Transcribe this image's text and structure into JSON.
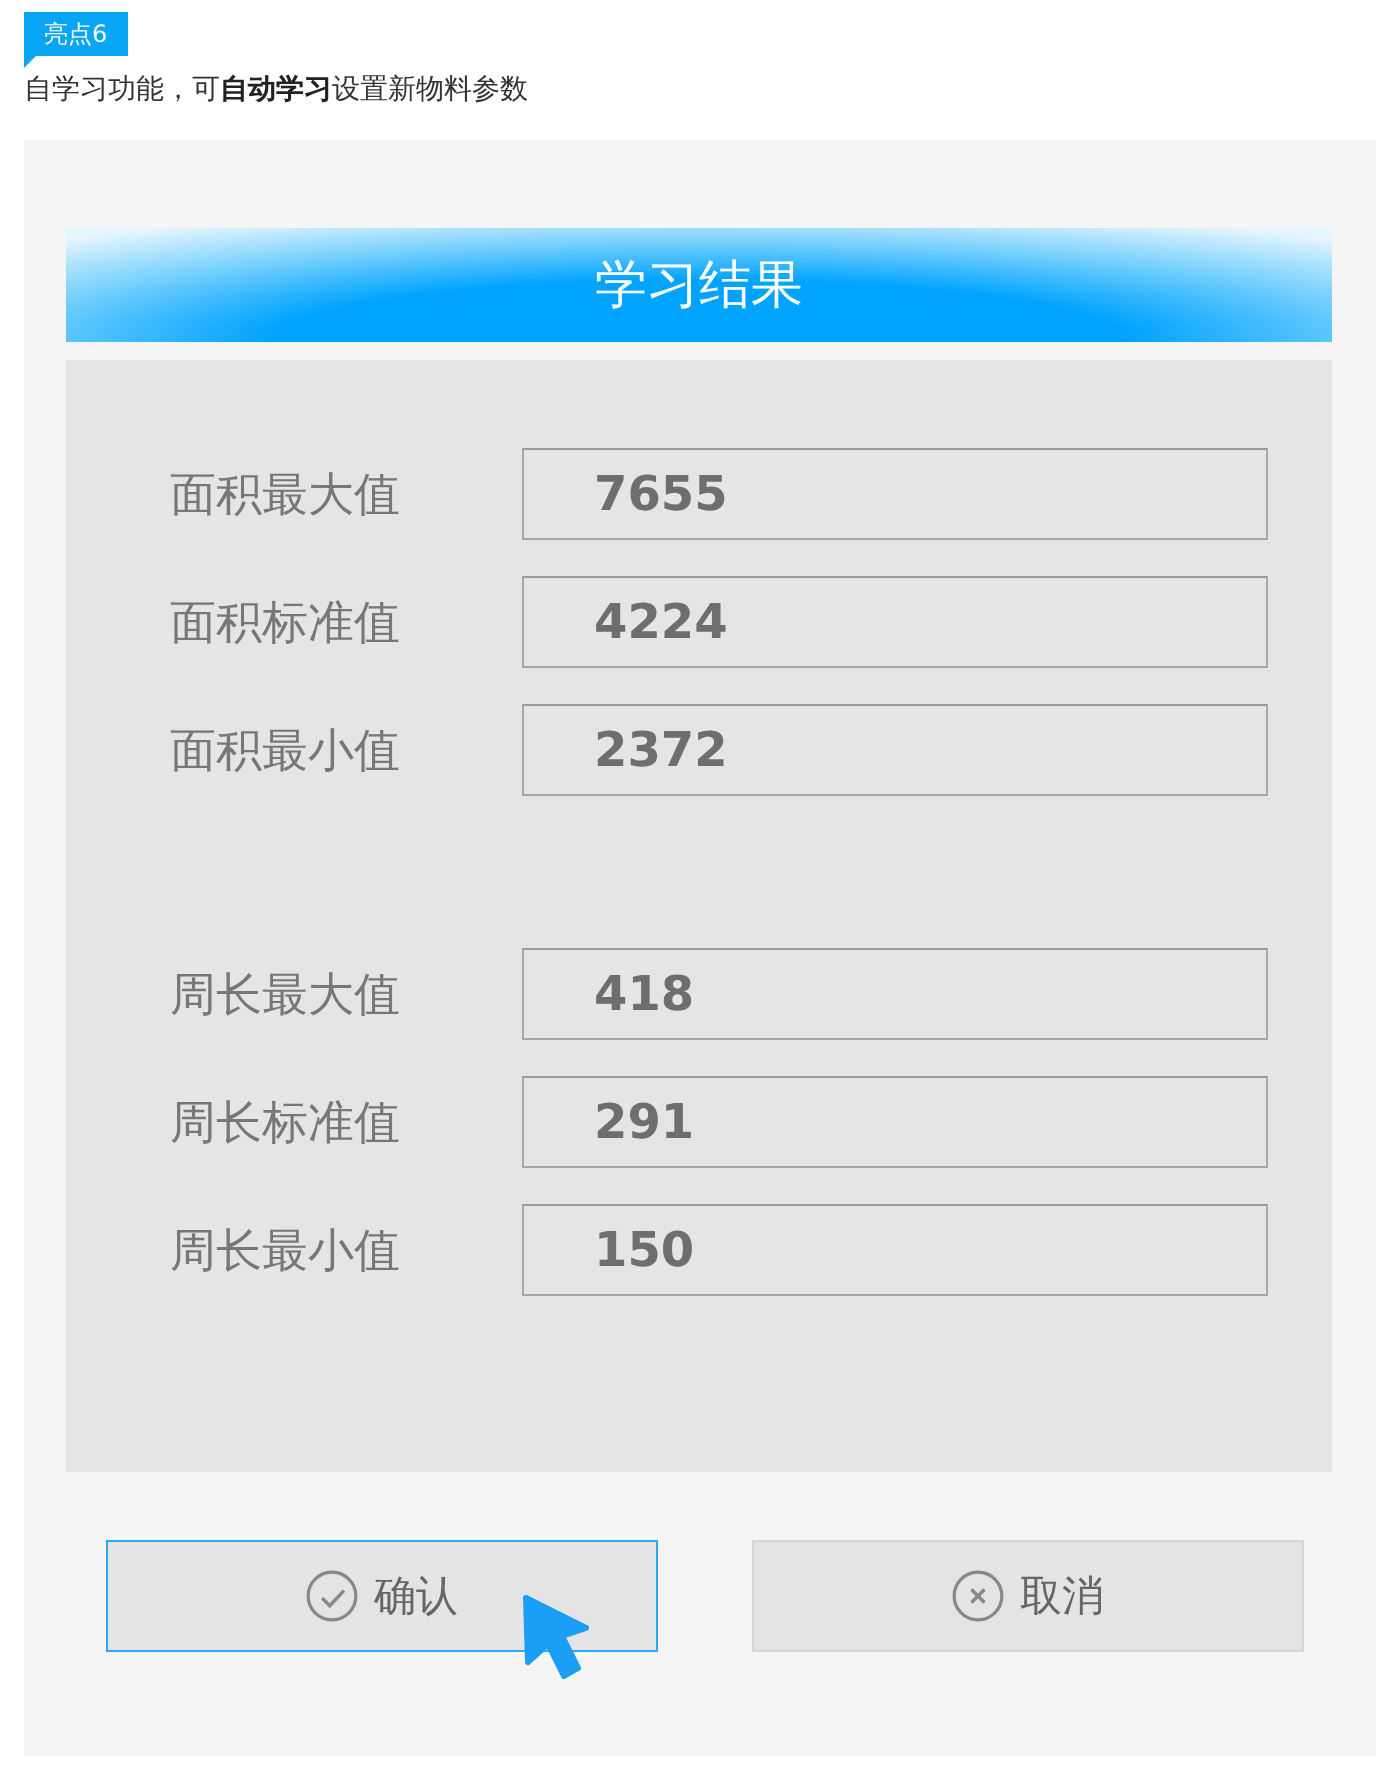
{
  "badge": "亮点6",
  "caption": "自学习功能，可**自动学习**设置新物料参数",
  "dialog": {
    "title": "学习结果",
    "groups": [
      {
        "rows": [
          {
            "label": "面积最大值",
            "value": "7655"
          },
          {
            "label": "面积标准值",
            "value": "4224"
          },
          {
            "label": "面积最小值",
            "value": "2372"
          }
        ]
      },
      {
        "rows": [
          {
            "label": "周长最大值",
            "value": "418"
          },
          {
            "label": "周长标准值",
            "value": "291"
          },
          {
            "label": "周长最小值",
            "value": "150"
          }
        ]
      }
    ],
    "buttons": [
      {
        "kind": "confirm",
        "label": "确认",
        "selected": true
      },
      {
        "kind": "cancel",
        "label": "取消",
        "selected": false
      }
    ]
  }
}
